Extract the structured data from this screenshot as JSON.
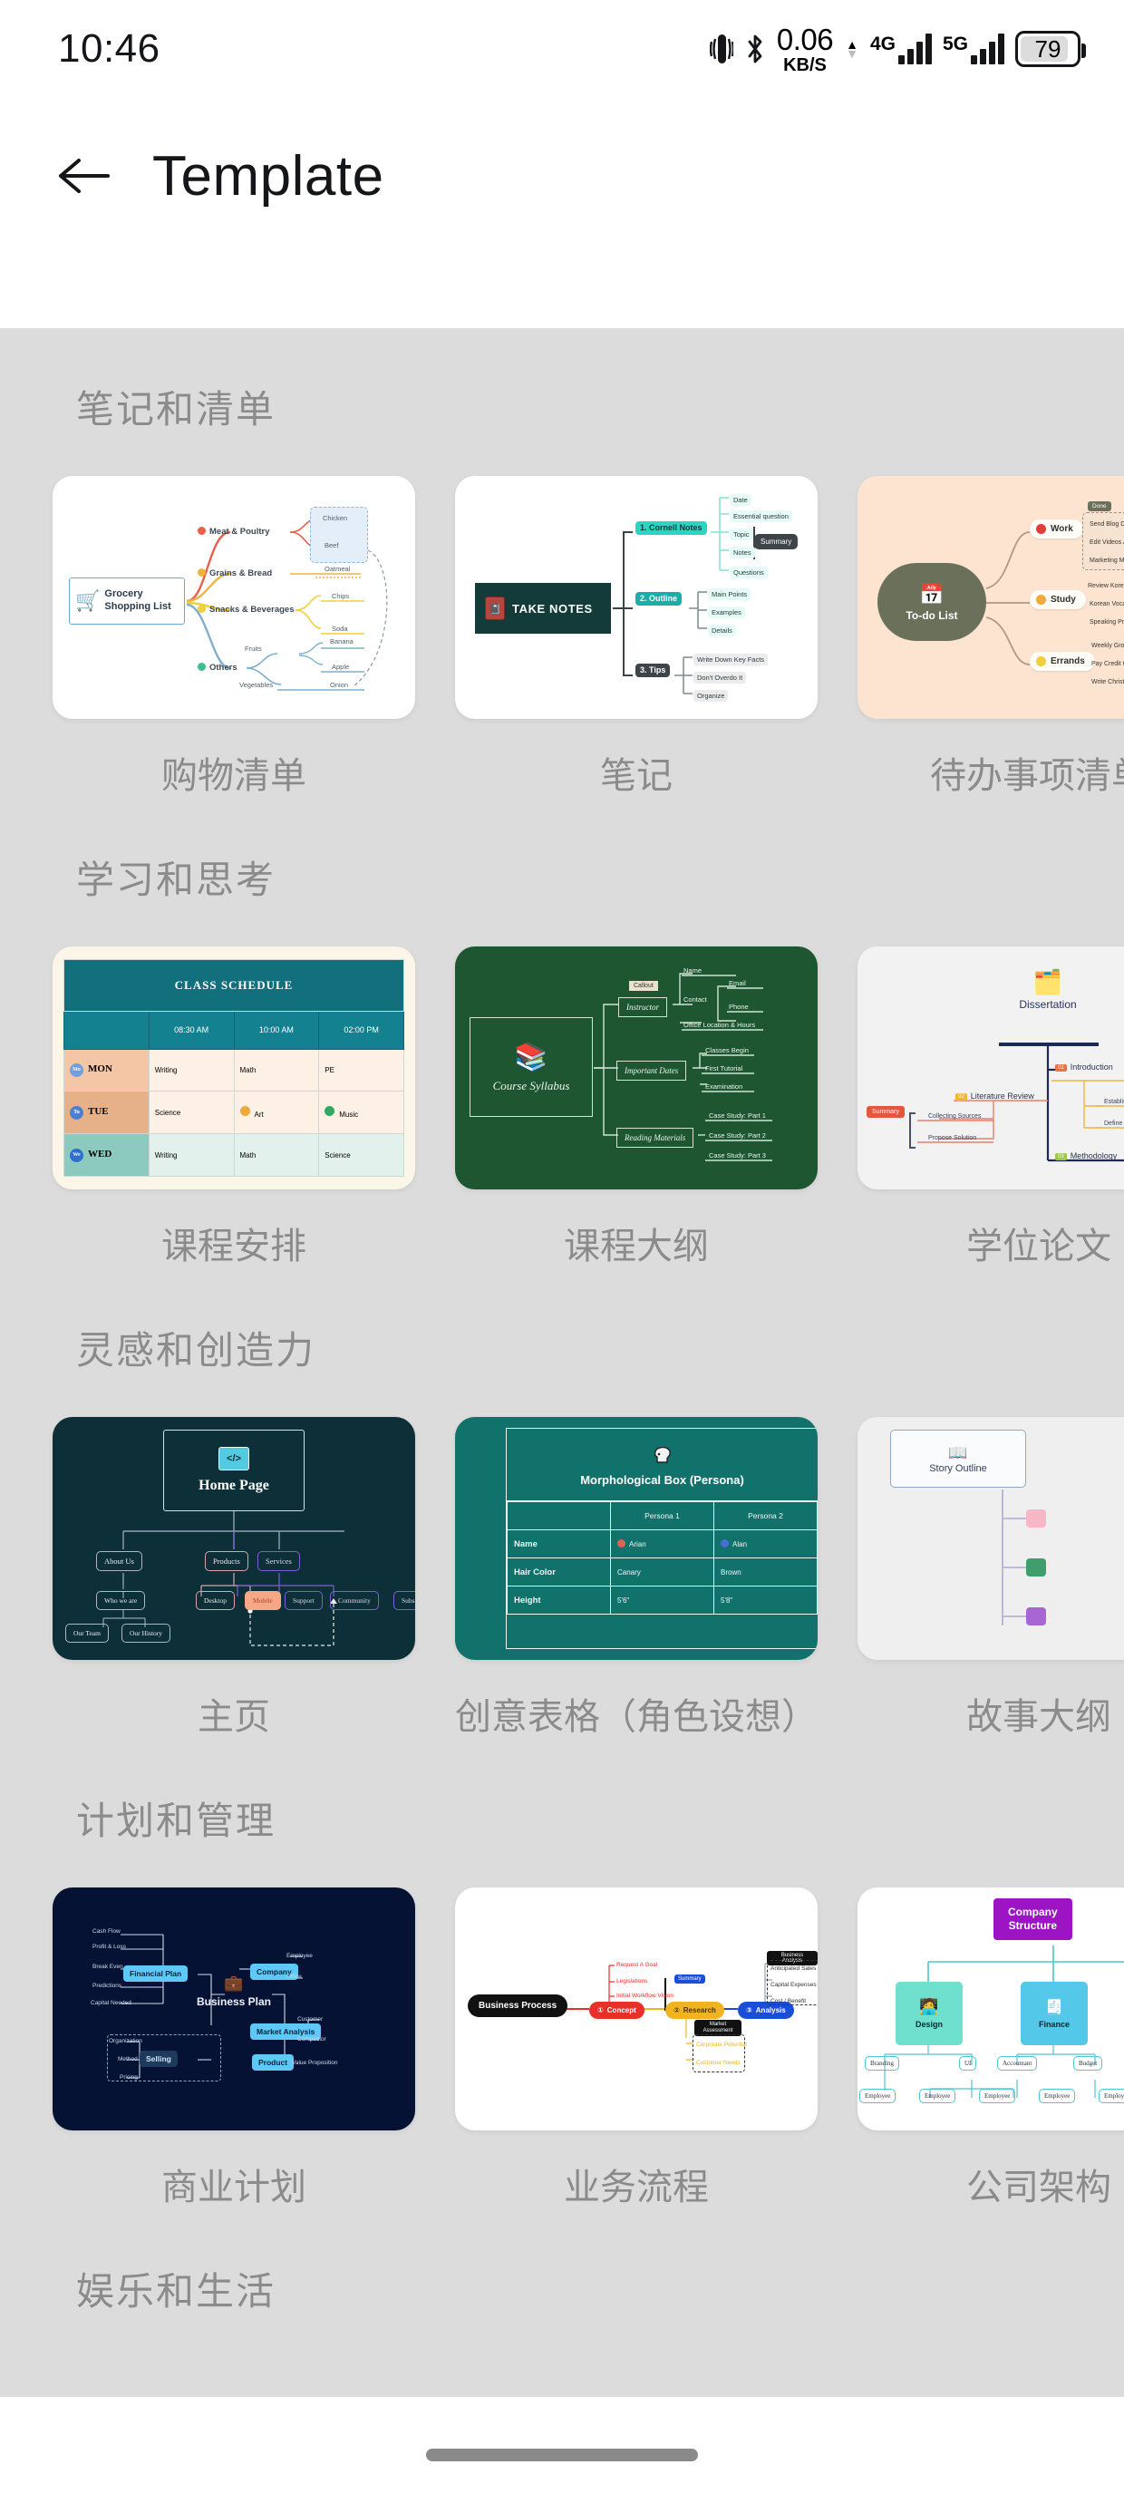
{
  "status_bar": {
    "time": "10:46",
    "vibrate_icon": "vibrate-icon",
    "bluetooth_icon": "bluetooth-icon",
    "net_speed_value": "0.06",
    "net_speed_unit": "KB/S",
    "signal_1_label": "4G",
    "signal_2_label": "5G",
    "battery_level": "79"
  },
  "app_bar": {
    "back_icon": "arrow-left-icon",
    "title": "Template"
  },
  "sections": [
    {
      "title": "笔记和清单",
      "cards": [
        {
          "label": "购物清单"
        },
        {
          "label": "笔记"
        },
        {
          "label": "待办事项清单"
        }
      ]
    },
    {
      "title": "学习和思考",
      "cards": [
        {
          "label": "课程安排"
        },
        {
          "label": "课程大纲"
        },
        {
          "label": "学位论文"
        }
      ]
    },
    {
      "title": "灵感和创造力",
      "cards": [
        {
          "label": "主页"
        },
        {
          "label": "创意表格（角色设想）"
        },
        {
          "label": "故事大纲"
        }
      ]
    },
    {
      "title": "计划和管理",
      "cards": [
        {
          "label": "商业计划"
        },
        {
          "label": "业务流程"
        },
        {
          "label": "公司架构"
        }
      ]
    },
    {
      "title": "娱乐和生活",
      "cards": []
    }
  ],
  "previews": {
    "grocery": {
      "root": "Grocery Shopping List",
      "root_icon": "shopping-cart-icon",
      "branches": [
        {
          "label": "Meat & Poultry",
          "color": "#e8604c",
          "leaves": [
            "Chicken",
            "Beef"
          ]
        },
        {
          "label": "Grains & Bread",
          "color": "#f0b53f",
          "leaves": [
            "Oatmeal"
          ]
        },
        {
          "label": "Snacks & Beverages",
          "color": "#f2cf3e",
          "leaves": [
            "Chips",
            "Soda"
          ]
        },
        {
          "label": "Others",
          "color": "#3cc08a",
          "leaves": [
            "Fruits",
            "Banana",
            "Apple",
            "Vegetables",
            "Onion"
          ]
        }
      ]
    },
    "take_notes": {
      "root": "TAKE NOTES",
      "root_icon": "notebook-icon",
      "branches": [
        {
          "label": "1. Cornell Notes",
          "leaves": [
            "Date",
            "Essential question",
            "Topic",
            "Notes",
            "Questions"
          ],
          "extra": "Summary"
        },
        {
          "label": "2. Outline",
          "leaves": [
            "Main Points",
            "Examples",
            "Details"
          ]
        },
        {
          "label": "3. Tips",
          "leaves": [
            "Write Down Key Facts",
            "Don't Overdo It",
            "Organize"
          ]
        }
      ]
    },
    "todo": {
      "root": "To-do List",
      "root_icon": "calendar-icon",
      "branches": [
        {
          "label": "Work",
          "tag": "Done",
          "leaves": [
            "Send Blog Draft To Editor",
            "Edit Videos And Publish",
            "Marketing Meeting"
          ]
        },
        {
          "label": "Study",
          "leaves": [
            "Review Korean Interview",
            "Korean Vocabulary",
            "Speaking Practice"
          ]
        },
        {
          "label": "Errands",
          "leaves": [
            "Weekly Grocery Shopping",
            "Pay Credit Card Bill",
            "Write Christmas Cards"
          ]
        }
      ]
    },
    "class_schedule": {
      "title": "CLASS SCHEDULE",
      "times": [
        "08:30 AM",
        "10:00 AM",
        "02:00 PM"
      ],
      "rows": [
        {
          "badge": "Mo",
          "day": "MON",
          "cells": [
            "Writing",
            "Math",
            "PE"
          ]
        },
        {
          "badge": "Tu",
          "day": "TUE",
          "cells": [
            "Science",
            "Art",
            "Music"
          ]
        },
        {
          "badge": "We",
          "day": "WED",
          "cells": [
            "Writing",
            "Math",
            "Science"
          ]
        }
      ]
    },
    "syllabus": {
      "root": "Course Syllabus",
      "root_icon": "books-icon",
      "callout": "Callout",
      "branches": [
        {
          "label": "Instructor",
          "leaves": [
            "Name",
            "Contact",
            "Email",
            "Phone",
            "Office Location & Hours"
          ]
        },
        {
          "label": "Important Dates",
          "leaves": [
            "Classes Begin",
            "First Tutorial",
            "Examination"
          ]
        },
        {
          "label": "Reading Materials",
          "leaves": [
            "Case Study: Part 1",
            "Case Study: Part 2",
            "Case Study: Part 3"
          ]
        }
      ]
    },
    "dissertation": {
      "root": "Dissertation",
      "root_icon": "study-tools-icon",
      "summary": "Summary",
      "branches": [
        {
          "num": "01",
          "label": "Introduction",
          "color": "#e8724a",
          "leaves": [
            "Establish Research Territory",
            "Define Scope"
          ]
        },
        {
          "num": "02",
          "label": "Literature Review",
          "color": "#f0b53f",
          "leaves": [
            "Collecting Sources",
            "Propose Solution"
          ]
        },
        {
          "num": "03",
          "label": "Methodology",
          "color": "#9dc84a",
          "leaves": []
        }
      ]
    },
    "home_page": {
      "root": "Home Page",
      "root_icon": "code-window-icon",
      "children": [
        {
          "label": "About Us",
          "color": "#aeb6c4",
          "leaves": [
            "Who we are",
            "Our Team",
            "Our History"
          ]
        },
        {
          "label": "Products",
          "color": "#d9a3b0",
          "leaves": [
            "Desktop",
            "Mobile"
          ]
        },
        {
          "label": "Services",
          "color": "#7b5fd4",
          "leaves": [
            "Support",
            "Community",
            "Subscription"
          ]
        }
      ]
    },
    "morphological": {
      "title": "Morphological Box (Persona)",
      "title_icon": "head-profile-icon",
      "columns": [
        "",
        "Persona 1",
        "Persona 2"
      ],
      "rows": [
        {
          "attr": "Name",
          "v1": "Arian",
          "v2": "Alan"
        },
        {
          "attr": "Hair Color",
          "v1": "Canary",
          "v2": "Brown"
        },
        {
          "attr": "Height",
          "v1": "5'6\"",
          "v2": "5'8\""
        }
      ]
    },
    "story_outline": {
      "root": "Story Outline",
      "root_icon": "open-book-icon"
    },
    "business_plan": {
      "root": "Business Plan",
      "root_icon": "briefcase-icon",
      "left": [
        {
          "label": "Financial Plan",
          "leaves": [
            "Cash Flow",
            "Profit & Loss",
            "Break Even",
            "Predictions",
            "Capital Needed"
          ]
        },
        {
          "label": "Selling",
          "leaves": [
            "Organization",
            "Method",
            "Pricing"
          ]
        }
      ],
      "right": [
        {
          "label": "Company",
          "leaves": [
            "Employee",
            "Office"
          ]
        },
        {
          "label": "Market Analysis",
          "leaves": [
            "Customer",
            "Competitor"
          ]
        },
        {
          "label": "Product",
          "leaves": [
            "Value Proposition"
          ]
        }
      ]
    },
    "business_process": {
      "root": "Business Process",
      "steps": [
        {
          "num": "01",
          "label": "Concept",
          "color": "#e8302a",
          "leaves": [
            "Request A Goal",
            "Legislations",
            "Initial Workflow Vision"
          ]
        },
        {
          "num": "02",
          "label": "Research",
          "color": "#f2b321",
          "leaves": [
            "Corporate Potential",
            "Customer Needs"
          ],
          "tag": "Market Assessment"
        },
        {
          "num": "03",
          "label": "Analysis",
          "color": "#1a4ed8",
          "leaves": [
            "Anticipated Sales",
            "Capital Expenses",
            "Cost / Benefit"
          ],
          "tag": "Business Analysis"
        }
      ],
      "summary": "Summary"
    },
    "company_structure": {
      "root": "Company Structure",
      "departments": [
        {
          "label": "Design",
          "icon": "designer-icon",
          "color": "#6fe0cd",
          "subs": [
            "Branding",
            "UI"
          ],
          "employees": [
            "Employee",
            "Employee",
            "Employee"
          ]
        },
        {
          "label": "Finance",
          "icon": "invoice-icon",
          "color": "#53c8e8",
          "subs": [
            "Accountant",
            "Budget"
          ],
          "employees": [
            "Employee",
            "Employee"
          ]
        }
      ]
    }
  },
  "navigation": {
    "home_pill": "home-indicator"
  },
  "colors": {
    "page_bg": "#dcdcdc",
    "card_bg": "#ffffff",
    "section_title": "#8b8b8b",
    "app_bar_text": "#15161a"
  }
}
